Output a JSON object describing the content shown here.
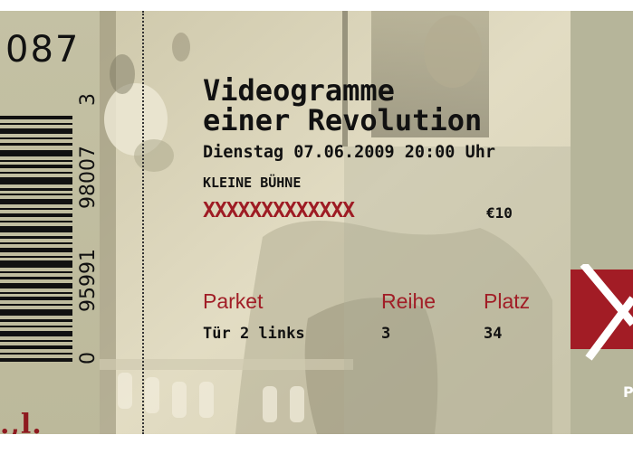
{
  "ticket": {
    "serial": "087",
    "barcode_number": "0 95991 98007 3",
    "barcode_digits": [
      "0",
      "95991",
      "98007",
      "3"
    ],
    "logo_fragment": ".,l.",
    "title_line1": "Videogramme",
    "title_line2": "einer Revolution",
    "datetime": "Dienstag 07.06.2009 20:00 Uhr",
    "venue": "KLEINE BÜHNE",
    "redacted_mark": "XXXXXXXXXXXXX",
    "price": "€10",
    "labels": {
      "section": "Parket",
      "row": "Reihe",
      "seat": "Platz"
    },
    "values": {
      "section": "Tür 2 links",
      "row": "3",
      "seat": "34"
    },
    "right_panel_letter": "P"
  },
  "colors": {
    "accent_red": "#a11d26",
    "stub_background": "#c4c1a4",
    "photo_tint": "#d9d4bb",
    "text": "#111111"
  }
}
